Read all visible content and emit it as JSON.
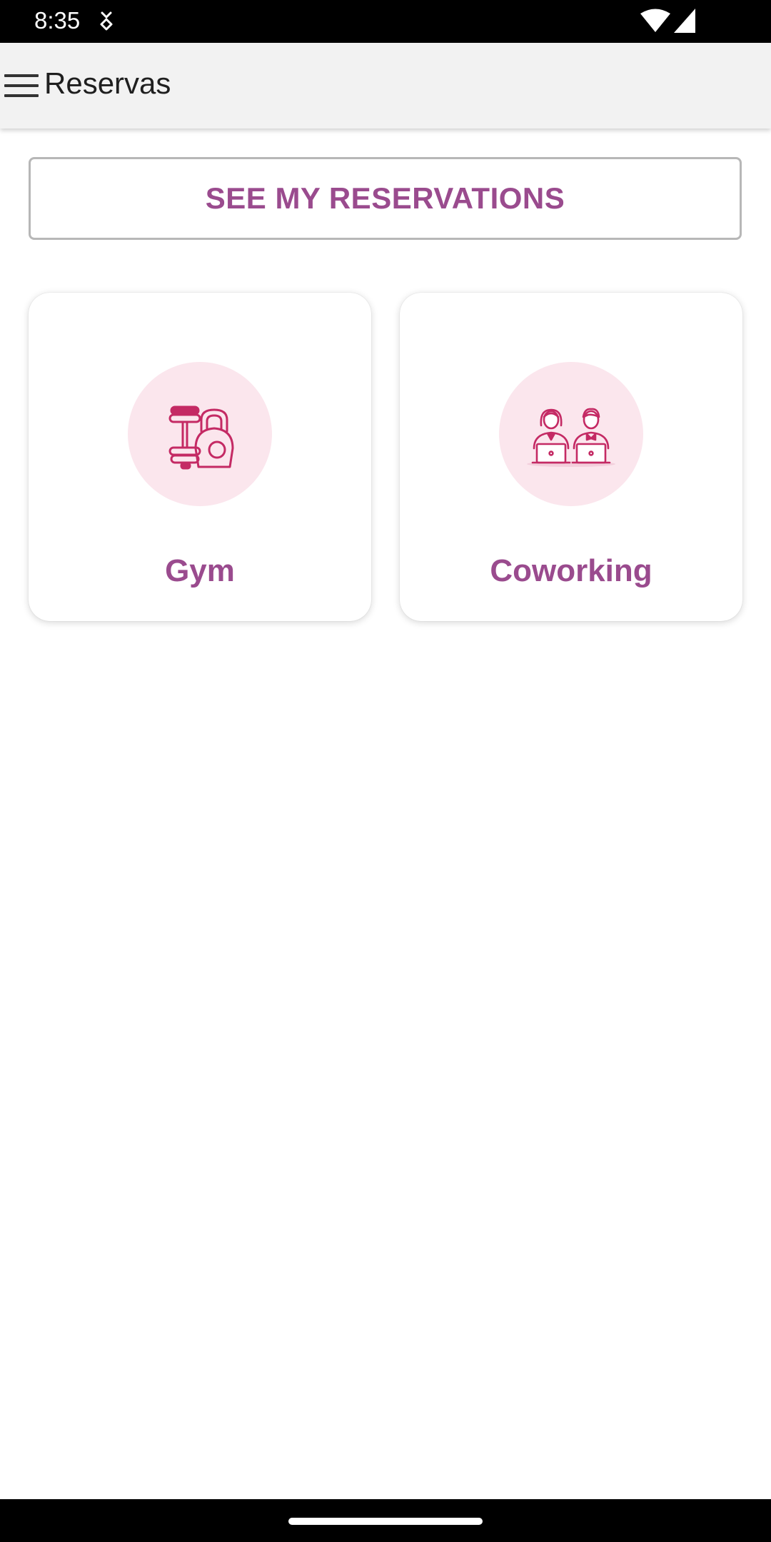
{
  "status_bar": {
    "time": "8:35",
    "icons": [
      "notification-icon",
      "wifi-icon",
      "signal-icon"
    ]
  },
  "app_bar": {
    "menu_icon": "hamburger-menu-icon",
    "title": "Reservas"
  },
  "actions": {
    "see_reservations_label": "SEE MY RESERVATIONS"
  },
  "categories": [
    {
      "label": "Gym",
      "icon": "dumbbell-kettlebell-icon"
    },
    {
      "label": "Coworking",
      "icon": "coworkers-laptops-icon"
    }
  ],
  "colors": {
    "accent": "#9a4b8e",
    "icon_stroke": "#c42a64",
    "icon_circle": "#fbe6ed",
    "app_bar": "#f2f2f2"
  },
  "nav_bar": {
    "home_indicator": "home-pill"
  }
}
